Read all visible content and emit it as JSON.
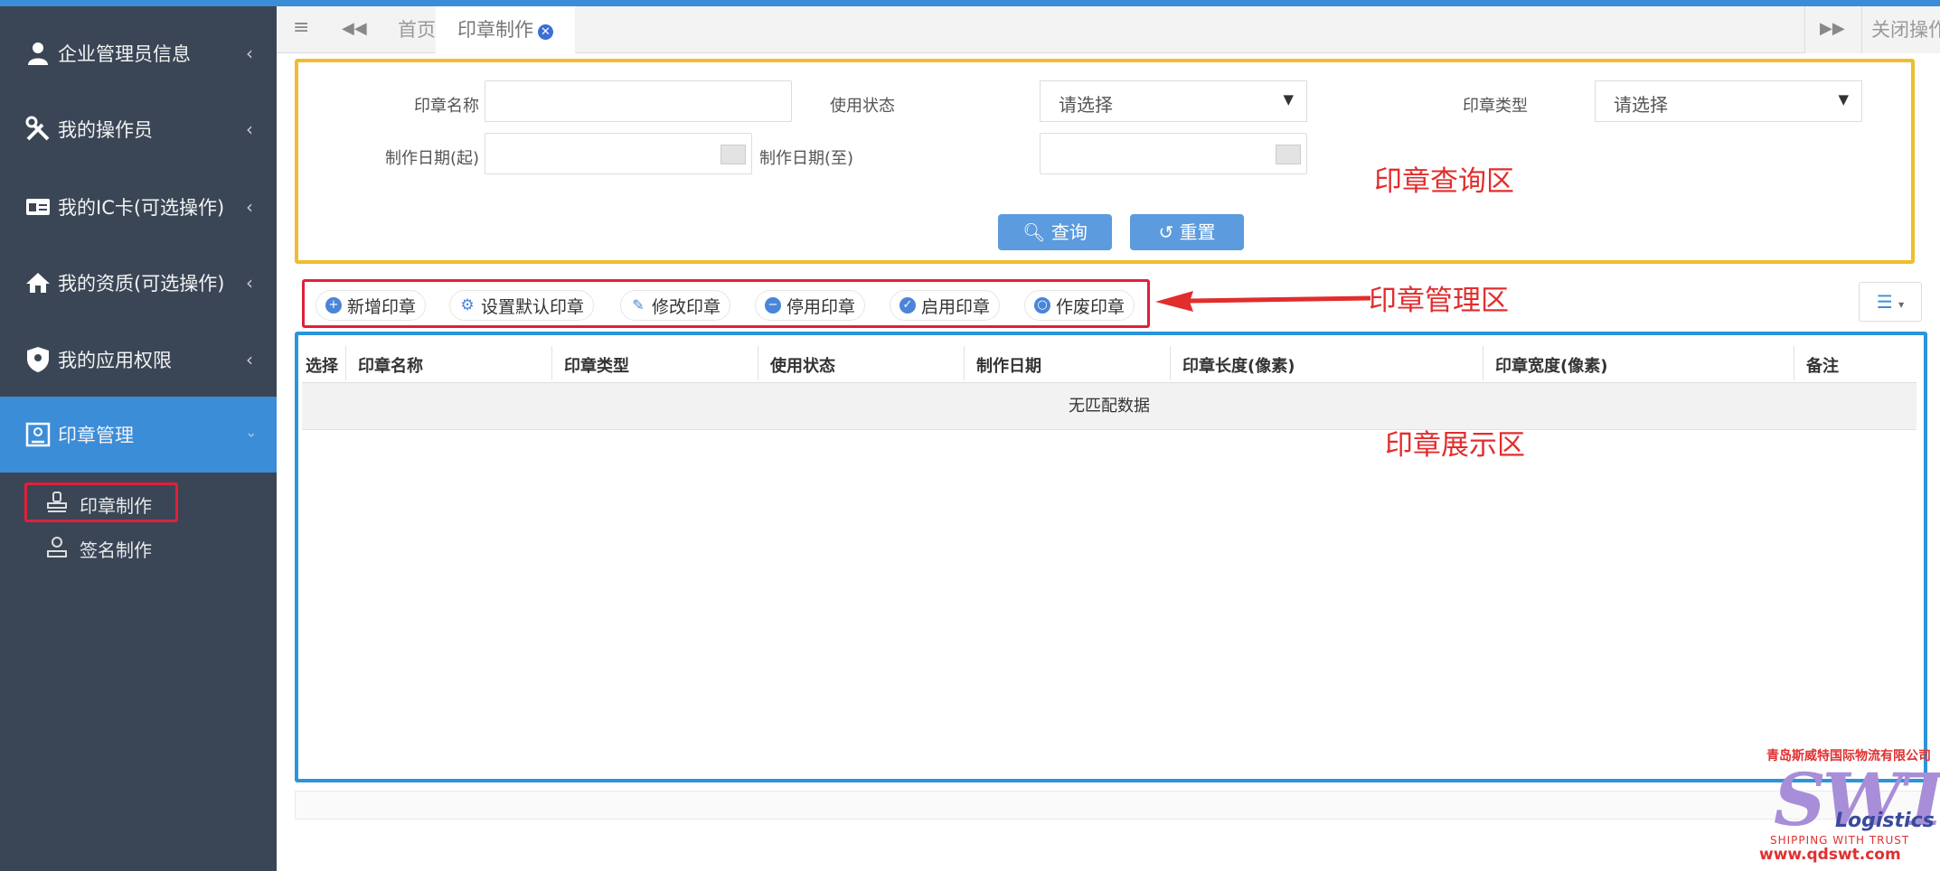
{
  "sidebar": {
    "items": [
      {
        "label": "企业管理员信息",
        "icon": "user-icon"
      },
      {
        "label": "我的操作员",
        "icon": "tools-icon"
      },
      {
        "label": "我的IC卡(可选操作)",
        "icon": "id-card-icon"
      },
      {
        "label": "我的资质(可选操作)",
        "icon": "home-icon"
      },
      {
        "label": "我的应用权限",
        "icon": "shield-icon"
      },
      {
        "label": "印章管理",
        "icon": "seal-manage-icon"
      }
    ],
    "sub_items": [
      {
        "label": "印章制作",
        "icon": "stamp-icon"
      },
      {
        "label": "签名制作",
        "icon": "person-icon"
      }
    ],
    "active_color": "#3c8dd8",
    "bg_color": "#3a4656"
  },
  "tabs": {
    "home": "首页",
    "current": "印章制作",
    "close_ops": "关闭操作"
  },
  "query": {
    "seal_name_label": "印章名称",
    "seal_name_value": "",
    "status_label": "使用状态",
    "status_value": "请选择",
    "type_label": "印章类型",
    "type_value": "请选择",
    "date_from_label": "制作日期(起)",
    "date_to_label": "制作日期(至)",
    "search_btn": "查询",
    "reset_btn": "重置"
  },
  "annotations": {
    "query_area": "印章查询区",
    "manage_area": "印章管理区",
    "display_area": "印章展示区"
  },
  "toolbar": {
    "add": "新增印章",
    "set_default": "设置默认印章",
    "edit": "修改印章",
    "disable": "停用印章",
    "enable": "启用印章",
    "void": "作废印章"
  },
  "table": {
    "columns": [
      "选择",
      "印章名称",
      "印章类型",
      "使用状态",
      "制作日期",
      "印章长度(像素)",
      "印章宽度(像素)",
      "备注"
    ],
    "empty_text": "无匹配数据"
  },
  "watermark": {
    "company": "青岛斯威特国际物流有限公司",
    "brand": "SWT",
    "sub": "Logistics",
    "slogan": "SHIPPING WITH TRUST",
    "url": "www.qdswt.com"
  }
}
